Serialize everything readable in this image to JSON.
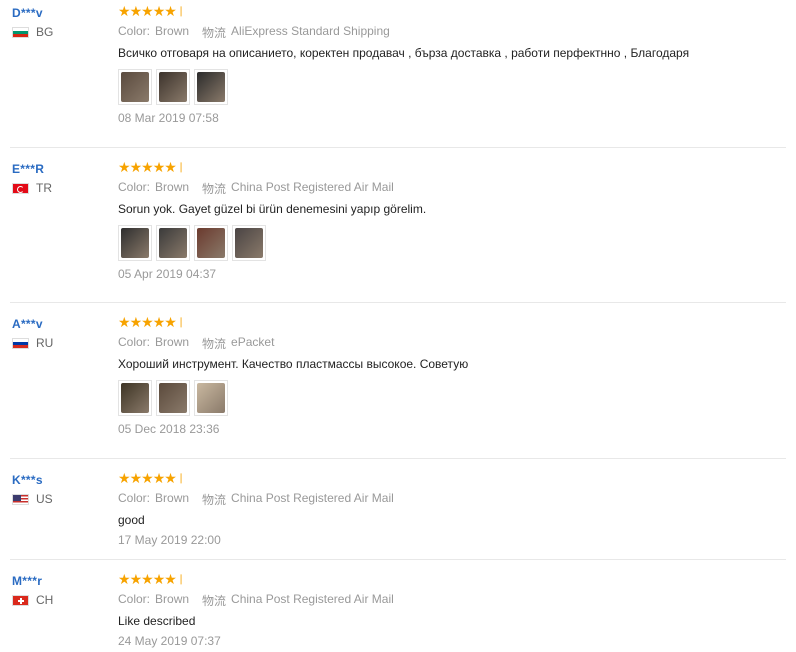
{
  "reviews": [
    {
      "user": "D***v",
      "country": "BG",
      "flag": "bg",
      "rating": 5,
      "color_label": "Color:",
      "color_value": "Brown",
      "ship_label": "物流",
      "ship_value": "AliExpress Standard Shipping",
      "text": "Всичко отговаря на описанието, коректен продавач , бърза доставка , работи перфектнно , Благодаря",
      "photos": [
        "#5a4a3e",
        "#3c332c",
        "#2b2b2b"
      ],
      "date": "08 Mar 2019 07:58"
    },
    {
      "user": "E***R",
      "country": "TR",
      "flag": "tr",
      "rating": 5,
      "color_label": "Color:",
      "color_value": "Brown",
      "ship_label": "物流",
      "ship_value": "China Post Registered Air Mail",
      "text": "Sorun yok. Gayet güzel bi ürün denemesini yapıp görelim.",
      "photos": [
        "#2e2e2e",
        "#3a3a3a",
        "#6b3a2e",
        "#4a4444"
      ],
      "date": "05 Apr 2019 04:37"
    },
    {
      "user": "A***v",
      "country": "RU",
      "flag": "ru",
      "rating": 5,
      "color_label": "Color:",
      "color_value": "Brown",
      "ship_label": "物流",
      "ship_value": "ePacket",
      "text": "Хороший инструмент. Качество пластмассы высокое. Советую",
      "photos": [
        "#3d3424",
        "#5b4a3c",
        "#c9b8a0"
      ],
      "date": "05 Dec 2018 23:36"
    },
    {
      "user": "K***s",
      "country": "US",
      "flag": "us",
      "rating": 5,
      "color_label": "Color:",
      "color_value": "Brown",
      "ship_label": "物流",
      "ship_value": "China Post Registered Air Mail",
      "text": "good",
      "photos": [],
      "date": "17 May 2019 22:00"
    },
    {
      "user": "M***r",
      "country": "CH",
      "flag": "ch",
      "rating": 5,
      "color_label": "Color:",
      "color_value": "Brown",
      "ship_label": "物流",
      "ship_value": "China Post Registered Air Mail",
      "text": "Like described",
      "photos": [],
      "date": "24 May 2019 07:37"
    }
  ]
}
